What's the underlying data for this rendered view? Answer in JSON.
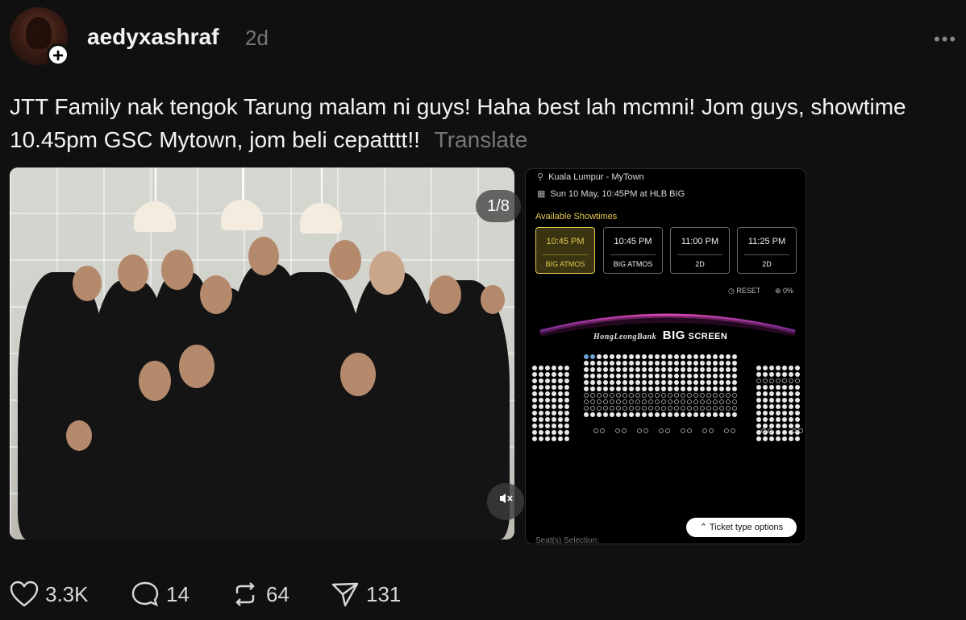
{
  "post": {
    "username": "aedyxashraf",
    "age": "2d",
    "text": "JTT Family nak tengok Tarung malam ni guys! Haha best lah mcmni! Jom guys, showtime 10.45pm GSC Mytown, jom beli cepatttt!!",
    "translate_label": "Translate",
    "more_icon": "more-horizontal-icon",
    "follow_icon": "plus-icon"
  },
  "media": {
    "counter": "1/8",
    "mute_icon": "mute-icon",
    "booking": {
      "location": "Kuala Lumpur - MyTown",
      "datetime": "Sun 10 May, 10:45PM at HLB BIG",
      "heading": "Available Showtimes",
      "showtimes": [
        {
          "time": "10:45 PM",
          "format": "BIG ATMOS",
          "selected": true
        },
        {
          "time": "10:45 PM",
          "format": "BIG ATMOS",
          "selected": false
        },
        {
          "time": "11:00 PM",
          "format": "2D",
          "selected": false
        },
        {
          "time": "11:25 PM",
          "format": "2D",
          "selected": false
        }
      ],
      "reset_label": "RESET",
      "zoom_label": "0%",
      "screen_bank": "HongLeongBank",
      "screen_big": "BIG",
      "screen_word": "SCREEN",
      "ticket_button": "Ticket type options",
      "seat_selection": "Seat(s) Selection:",
      "accent_color": "#e3c84f",
      "screen_color": "#c2399c"
    }
  },
  "actions": {
    "likes": "3.3K",
    "comments": "14",
    "reposts": "64",
    "shares": "131"
  }
}
